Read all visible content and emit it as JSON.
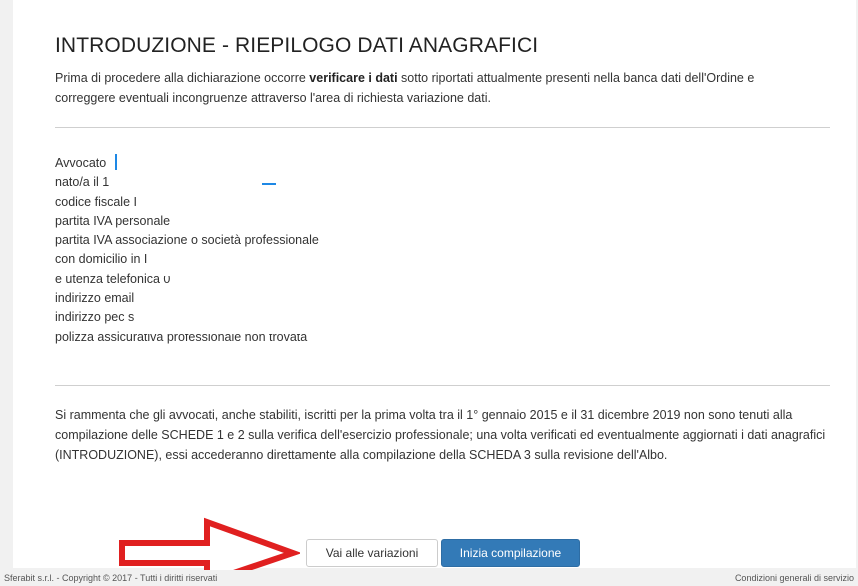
{
  "page": {
    "title": "INTRODUZIONE - RIEPILOGO DATI ANAGRAFICI",
    "intro": {
      "before": "Prima di procedere alla dichiarazione occorre ",
      "bold": "verificare i dati",
      "after": " sotto riportati attualmente presenti nella banca dati dell'Ordine e correggere eventuali incongruenze attraverso l'area di richiesta variazione dati."
    }
  },
  "anagrafica": [
    "Avvocato",
    "nato/a il 1",
    "codice fiscale I",
    "partita IVA personale",
    "partita IVA associazione o società professionale",
    "con domicilio in I",
    "e utenza telefonica 0",
    "indirizzo email",
    "indirizzo pec s",
    "polizza assicurativa professionale non trovata"
  ],
  "reminder": "Si rammenta che gli avvocati, anche stabiliti, iscritti per la prima volta tra il 1° gennaio 2015 e il 31 dicembre 2019 non sono tenuti alla compilazione delle SCHEDE 1 e 2 sulla verifica dell'esercizio professionale; una volta verificati ed eventualmente aggiornati i dati anagrafici (INTRODUZIONE), essi accederanno direttamente alla compilazione della SCHEDA 3 sulla revisione dell'Albo.",
  "actions": {
    "variazioni_label": "Vai alle variazioni",
    "compilazione_label": "Inizia compilazione"
  },
  "footer": {
    "copyright": "Sferabit s.r.l. - Copyright © 2017 - Tutti i diritti riservati",
    "conditions": "Condizioni generali di servizio"
  },
  "colors": {
    "primary": "#337ab7",
    "annotation_arrow": "#e02020"
  },
  "icons": {
    "annotation": "arrow-right-icon"
  }
}
